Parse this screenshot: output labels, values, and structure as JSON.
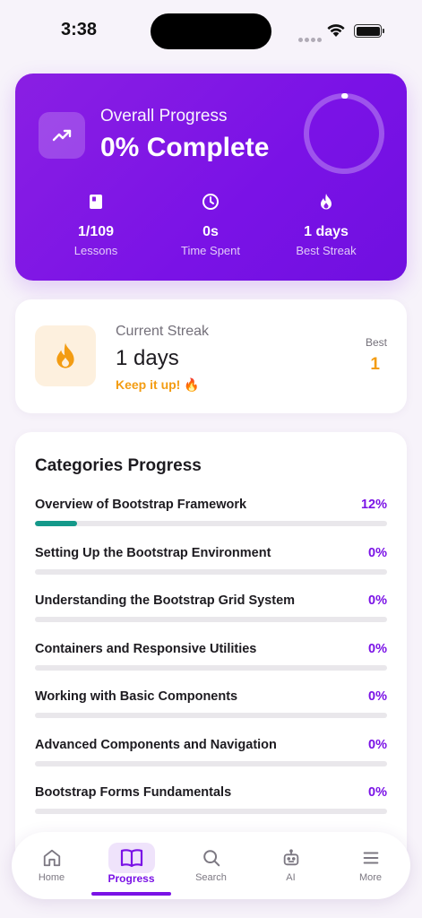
{
  "status_bar": {
    "time": "3:38"
  },
  "overview": {
    "label": "Overall Progress",
    "value": "0% Complete",
    "progress_fraction": 0,
    "stats": [
      {
        "icon": "book-icon",
        "value": "1/109",
        "label": "Lessons"
      },
      {
        "icon": "clock-icon",
        "value": "0s",
        "label": "Time Spent"
      },
      {
        "icon": "flame-icon",
        "value": "1 days",
        "label": "Best Streak"
      }
    ]
  },
  "streak": {
    "label": "Current Streak",
    "value": "1 days",
    "cheer": "Keep it up! 🔥",
    "best_label": "Best",
    "best_value": "1",
    "accent_color": "#f39c12"
  },
  "categories": {
    "title": "Categories Progress",
    "items": [
      {
        "name": "Overview of Bootstrap Framework",
        "percent_label": "12%",
        "percent": 12
      },
      {
        "name": "Setting Up the Bootstrap Environment",
        "percent_label": "0%",
        "percent": 0
      },
      {
        "name": "Understanding the Bootstrap Grid System",
        "percent_label": "0%",
        "percent": 0
      },
      {
        "name": "Containers and Responsive Utilities",
        "percent_label": "0%",
        "percent": 0
      },
      {
        "name": "Working with Basic Components",
        "percent_label": "0%",
        "percent": 0
      },
      {
        "name": "Advanced Components and Navigation",
        "percent_label": "0%",
        "percent": 0
      },
      {
        "name": "Bootstrap Forms Fundamentals",
        "percent_label": "0%",
        "percent": 0
      }
    ]
  },
  "nav": {
    "items": [
      {
        "label": "Home",
        "icon": "home-icon",
        "active": false
      },
      {
        "label": "Progress",
        "icon": "book-open-icon",
        "active": true
      },
      {
        "label": "Search",
        "icon": "search-icon",
        "active": false
      },
      {
        "label": "AI",
        "icon": "robot-icon",
        "active": false
      },
      {
        "label": "More",
        "icon": "menu-icon",
        "active": false
      }
    ]
  },
  "colors": {
    "brand": "#7a12e6",
    "progress_fill": "#14998a",
    "streak_accent": "#f39c12"
  }
}
